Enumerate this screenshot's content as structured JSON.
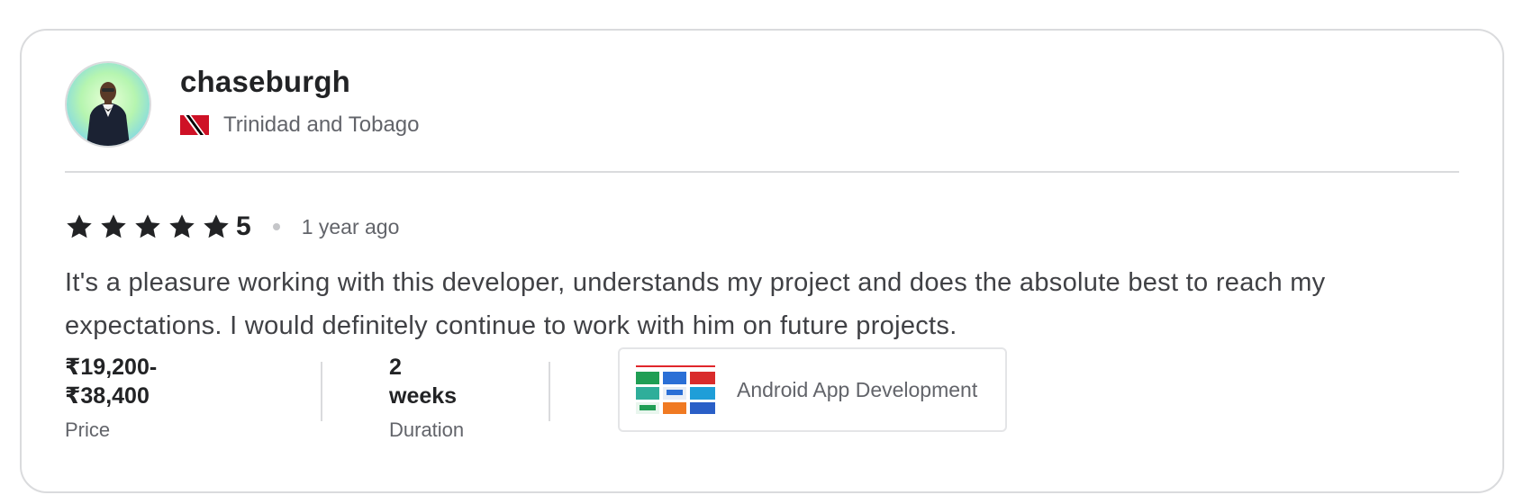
{
  "reviewer": {
    "username": "chaseburgh",
    "country": "Trinidad and Tobago",
    "avatar_icon": "profile-photo",
    "flag_icon": "trinidad-and-tobago-flag"
  },
  "rating": {
    "score": "5",
    "stars": 5,
    "time_ago": "1 year ago"
  },
  "review": {
    "text": "It's a pleasure working with this developer, understands my project and does the absolute best to reach my expectations. I would definitely continue to work with him on future projects."
  },
  "details": {
    "price_value": "₹19,200-₹38,400",
    "price_label": "Price",
    "duration_value": "2 weeks",
    "duration_label": "Duration"
  },
  "gig": {
    "title": "Android App Development",
    "thumbnail_icon": "gig-thumbnail"
  },
  "colors": {
    "text_primary": "#222325",
    "text_secondary": "#62646a",
    "border": "#dadbdd",
    "star": "#222325"
  }
}
